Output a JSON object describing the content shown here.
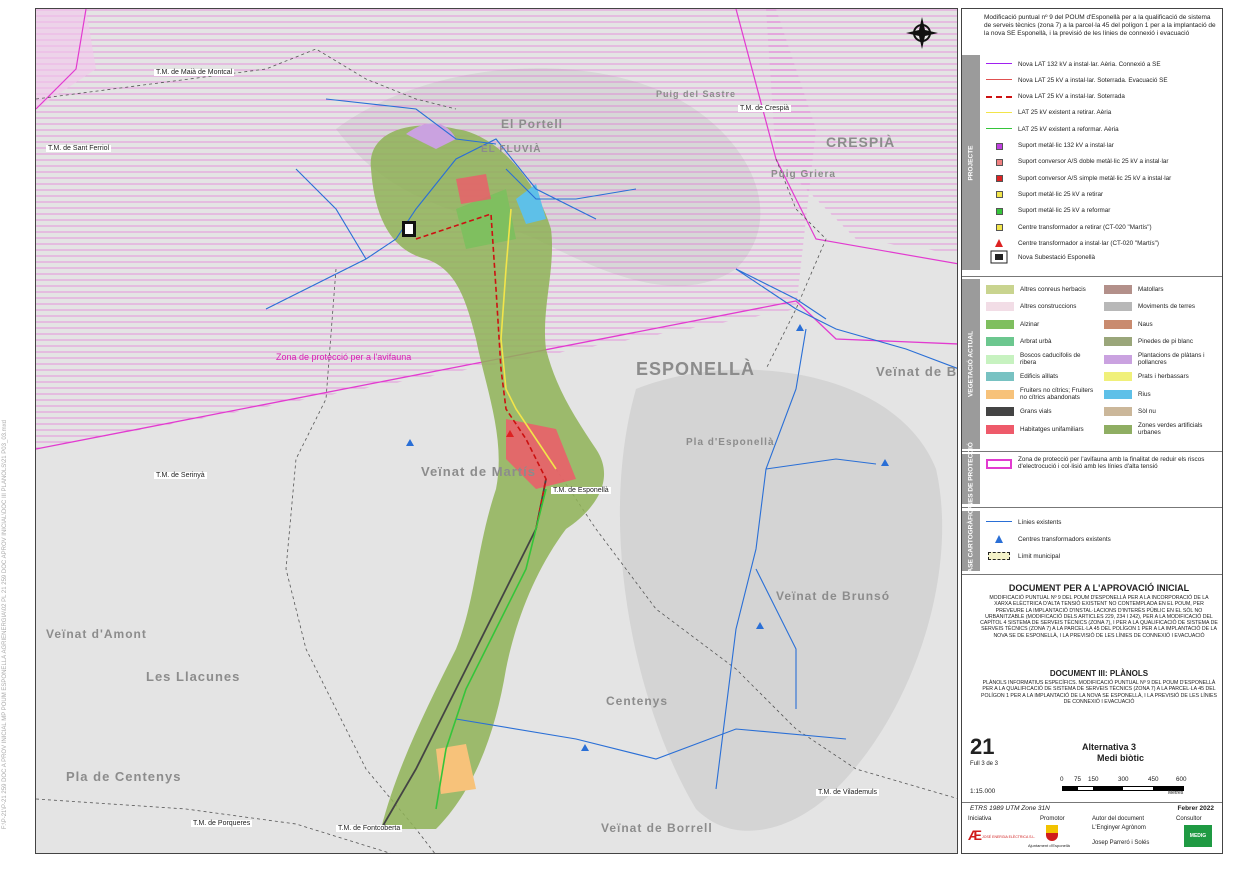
{
  "map": {
    "places": [
      {
        "key": "esponella",
        "text": "ESPONELLÀ"
      },
      {
        "key": "crespia",
        "text": "CRESPIÀ"
      },
      {
        "key": "veinat_ballori",
        "text": "Veïnat de Batllori"
      },
      {
        "key": "veinat_marti",
        "text": "Veïnat de Martís"
      },
      {
        "key": "veinat_brunso",
        "text": "Veïnat de Brunsó"
      },
      {
        "key": "centenys",
        "text": "Centenys"
      },
      {
        "key": "veinat_borrell",
        "text": "Veïnat de Borrell"
      },
      {
        "key": "pla_centenys",
        "text": "Pla de Centenys"
      },
      {
        "key": "pla_esponella",
        "text": "Pla d'Esponellà"
      },
      {
        "key": "les_llacunes",
        "text": "Les Llacunes"
      },
      {
        "key": "veinat_amont",
        "text": "Veïnat d'Amont"
      },
      {
        "key": "el_portell",
        "text": "El Portell"
      },
      {
        "key": "el_fluvia",
        "text": "EL FLUVIÀ"
      },
      {
        "key": "puig_griera",
        "text": "Puig Griera"
      },
      {
        "key": "puig_sastre",
        "text": "Puig del Sastre"
      }
    ],
    "municipal_labels": [
      {
        "key": "maia",
        "text": "T.M. de Maià de Montcal"
      },
      {
        "key": "crespia",
        "text": "T.M. de Crespià"
      },
      {
        "key": "ferriol",
        "text": "T.M. de Sant Ferriol"
      },
      {
        "key": "serinya",
        "text": "T.M. de Serinyà"
      },
      {
        "key": "esponella",
        "text": "T.M. de Esponellà"
      },
      {
        "key": "vilademuls",
        "text": "T.M. de Vilademuls"
      },
      {
        "key": "porqueres",
        "text": "T.M. de Porqueres"
      },
      {
        "key": "fontcoberta",
        "text": "T.M. de Fontcoberta"
      }
    ],
    "protection_zone_label": "Zona de protecció per a l'avifauna",
    "side_note": "F:\\P-21\\P-21 259 DOC A PROV INICIAL MP POUM ESPONELLÀ AGRIENERGIA\\02 PL 21 259 DOC APROV INICIAL\\DOC III PLANOLS\\21 P03_03.mxd",
    "colors": {
      "background": "#e6e6e6",
      "vegetation": "#8fb357",
      "protection": "#e23bd0",
      "existing_lines": "#2a6fd6",
      "new_25kv_buried": "#d62020",
      "lat_retire": "#f2e54a",
      "lat_reform": "#35c43a",
      "road": "#444444"
    }
  },
  "panel": {
    "project_title": "Modificació puntual nº 9 del POUM d'Esponellà per a la qualificació de sistema de serveis tècnics (zona 7) a la parcel·la 45 del polígon 1 per a la implantació de la nova SE Esponellà, i la previsió de les línies de connexió i evacuació",
    "north": {
      "n": "N",
      "s": "S",
      "e": "E",
      "w": "W"
    },
    "sections": {
      "projecte": "PROJECTE",
      "vegetacio": "VEGETACIÓ ACTUAL",
      "zones": "ZONES DE PROTECCIÓ",
      "base": "BASE CARTOGRÀFICA"
    },
    "project_items": [
      {
        "key": "lat132",
        "label": "Nova LAT 132 kV a instal·lar. Aèria. Connexió a SE",
        "color": "#a020f0",
        "style": "solid"
      },
      {
        "key": "lat25sot_evac",
        "label": "Nova LAT 25 kV a instal·lar. Soterrada. Evacuació SE",
        "color": "#e05050",
        "style": "solid"
      },
      {
        "key": "lat25sot",
        "label": "Nova LAT 25 kV a instal·lar. Soterrada",
        "color": "#cc1111",
        "style": "dashed"
      },
      {
        "key": "lat25ret",
        "label": "LAT 25 kV existent a retirar. Aèria",
        "color": "#f2e54a",
        "style": "solid"
      },
      {
        "key": "lat25ref",
        "label": "LAT 25 kV existent a reformar. Aèria",
        "color": "#35c43a",
        "style": "solid"
      },
      {
        "key": "sup132",
        "label": "Suport metàl·lic 132 kV a instal·lar",
        "color": "#c040e0",
        "style": "square"
      },
      {
        "key": "supdoble",
        "label": "Suport conversor A/S doble metàl·lic 25 kV a instal·lar",
        "color": "#f08080",
        "style": "square"
      },
      {
        "key": "supsimple",
        "label": "Suport conversor A/S simple metàl·lic 25 kV a instal·lar",
        "color": "#dd2222",
        "style": "square"
      },
      {
        "key": "supret",
        "label": "Suport metàl·lic 25 kV a retirar",
        "color": "#f2e54a",
        "style": "square"
      },
      {
        "key": "supref",
        "label": "Suport metàl·lic 25 kV a reformar",
        "color": "#35c43a",
        "style": "square"
      },
      {
        "key": "ctret",
        "label": "Centre transformador a retirar (CT-020 \"Martís\")",
        "color": "#f2e54a",
        "style": "square"
      },
      {
        "key": "ctins",
        "label": "Centre transformador a instal·lar (CT-020 \"Martís\")",
        "color": "#dd2222",
        "style": "triangle"
      },
      {
        "key": "se",
        "label": "Nova Subestació Esponellà",
        "color": "#222222",
        "style": "substation"
      }
    ],
    "vegetation_items": [
      {
        "label": "Altres conreus herbacis",
        "color": "#c9d48f"
      },
      {
        "label": "Matollars",
        "color": "#b3908a"
      },
      {
        "label": "Altres construccions",
        "color": "#f2dde6"
      },
      {
        "label": "Moviments de terres",
        "color": "#b8b8b8"
      },
      {
        "label": "Alzinar",
        "color": "#7fbf5f"
      },
      {
        "label": "Naus",
        "color": "#c98b6f"
      },
      {
        "label": "Arbrat urbà",
        "color": "#6cc78f"
      },
      {
        "label": "Pinedes de pi blanc",
        "color": "#9aa67a"
      },
      {
        "label": "Boscos caducifolis de ribera",
        "color": "#c7f2c0"
      },
      {
        "label": "Plantacions de plàtans i pollancres",
        "color": "#caa2e0"
      },
      {
        "label": "Edificis aïllats",
        "color": "#78c2c2"
      },
      {
        "label": "Prats i herbassars",
        "color": "#f0f07a"
      },
      {
        "label": "Fruiters no cítrics; Fruiters no cítrics abandonats",
        "color": "#f7c27a"
      },
      {
        "label": "Rius",
        "color": "#5ec0e8"
      },
      {
        "label": "Grans vials",
        "color": "#444444"
      },
      {
        "label": "Sòl nu",
        "color": "#cbb79a"
      },
      {
        "label": "Habitatges unifamiliars",
        "color": "#ee5a6a"
      },
      {
        "label": "Zones verdes artificials urbanes",
        "color": "#8fae63"
      }
    ],
    "zone_item": "Zona de protecció per l'avifauna amb la finalitat de reduir els riscos d'electrocució i col·lisió amb les línies d'alta tensió",
    "base_items": [
      {
        "key": "lines",
        "label": "Línies existents"
      },
      {
        "key": "ct",
        "label": "Centres transformadors existents"
      },
      {
        "key": "limit",
        "label": "Límit municipal"
      }
    ],
    "doc_title": "DOCUMENT PER A L'APROVACIÓ INICIAL",
    "doc_text": "MODIFICACIÓ PUNTUAL Nº 9 DEL POUM D'ESPONELLÀ PER A LA INCORPORACIÓ DE LA XARXA ELÈCTRICA D'ALTA TENSIÓ EXISTENT NO CONTEMPLADA EN EL POUM, PER PREVEURE LA IMPLANTACIÓ D'INSTAL·LACIONS D'INTERÈS PÚBLIC EN EL SÒL NO URBANITZABLE (MODIFICACIÓ DELS ARTICLES 229, 234 I 242), PER A LA MODIFICACIÓ DEL CAPÍTOL 4 SISTEMA DE SERVEIS TÈCNICS (ZONA 7), I PER A LA QUALIFICACIÓ DE SISTEMA DE SERVEIS TÈCNICS (ZONA 7) A LA PARCEL·LA 45 DEL POLÍGON 1 PER A LA IMPLANTACIÓ DE LA NOVA SE DE ESPONELLÀ, I LA PREVISIÓ DE LES LÍNIES DE CONNEXIÓ I EVACUACIÓ",
    "doc3_title": "DOCUMENT III: PLÀNOLS",
    "doc3_text": "PLÀNOLS INFORMATIUS ESPECÍFICS. MODIFICACIÓ PUNTUAL Nº 9 DEL POUM D'ESPONELLÀ PER A LA QUALIFICACIÓ DE SISTEMA DE SERVEIS TÈCNICS (ZONA 7) A LA PARCEL·LA 45 DEL POLÍGON 1 PER A LA IMPLANTACIÓ DE LA NOVA SE ESPONELLÀ, I LA PREVISIÓ DE LES LÍNIES DE CONNEXIÓ I EVACUACIÓ",
    "sheet_number": "21",
    "sheet_of": "Full 3 de 3",
    "alt_title": "Alternativa 3",
    "alt_sub": "Medi biòtic",
    "scale": "1:15.000",
    "scale_ticks": [
      "0",
      "75",
      "150",
      "300",
      "450",
      "600"
    ],
    "scale_unit": "Metres",
    "crs": "ETRS 1989 UTM Zone 31N",
    "date": "Febrer 2022",
    "footer": {
      "iniciativa": "Iniciativa",
      "promotor": "Promotor",
      "autor": "Autor del document",
      "consultor": "Consultor",
      "engineer": "L'Enginyer Agrònom",
      "author_name": "Josep Parreró i Solés",
      "ajuntament": "Ajuntament d'Esponellà",
      "company": "JOSÉ ENERGIA ELÈCTRICA S.L.",
      "consultor_logo": "MEDIG"
    }
  }
}
